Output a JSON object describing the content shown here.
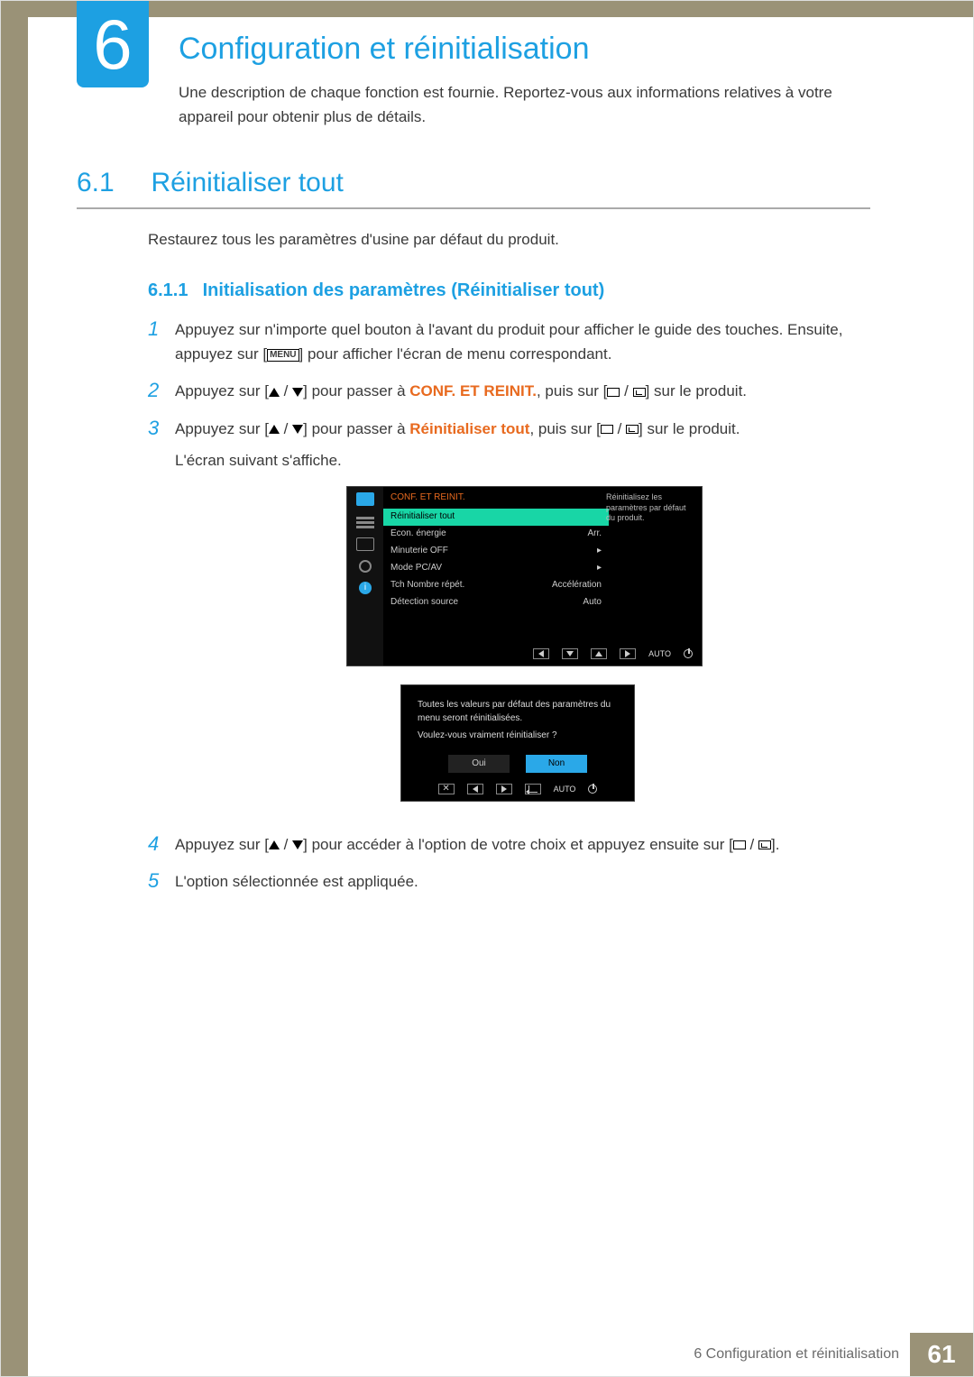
{
  "chapter": {
    "number": "6",
    "title": "Configuration et réinitialisation",
    "description": "Une description de chaque fonction est fournie. Reportez-vous aux informations relatives à votre appareil pour obtenir plus de détails."
  },
  "section": {
    "number": "6.1",
    "title": "Réinitialiser tout",
    "intro": "Restaurez tous les paramètres d'usine par défaut du produit."
  },
  "subsection": {
    "number": "6.1.1",
    "title": "Initialisation des paramètres (Réinitialiser tout)"
  },
  "steps": {
    "s1": {
      "num": "1",
      "text_a": "Appuyez sur n'importe quel bouton à l'avant du produit pour afficher le guide des touches. Ensuite, appuyez sur [",
      "menu": "MENU",
      "text_b": "] pour afficher l'écran de menu correspondant."
    },
    "s2": {
      "num": "2",
      "text_a": "Appuyez sur [",
      "text_b": "] pour passer à ",
      "target": "CONF. ET REINIT.",
      "text_c": ", puis sur [",
      "text_d": "] sur le produit."
    },
    "s3": {
      "num": "3",
      "text_a": "Appuyez sur [",
      "text_b": "] pour passer à ",
      "target": "Réinitialiser tout",
      "text_c": ", puis sur [",
      "text_d": "] sur le produit.",
      "text_e": "L'écran suivant s'affiche."
    },
    "s4": {
      "num": "4",
      "text_a": "Appuyez sur [",
      "text_b": "] pour accéder à l'option de votre choix et appuyez ensuite sur [",
      "text_c": "]."
    },
    "s5": {
      "num": "5",
      "text": "L'option sélectionnée est appliquée."
    }
  },
  "osd": {
    "header": "CONF. ET REINIT.",
    "items": [
      {
        "label": "Réinitialiser tout",
        "value": "",
        "selected": true
      },
      {
        "label": "Econ. énergie",
        "value": "Arr."
      },
      {
        "label": "Minuterie OFF",
        "value": "▸"
      },
      {
        "label": "Mode PC/AV",
        "value": "▸"
      },
      {
        "label": "Tch Nombre répét.",
        "value": "Accélération"
      },
      {
        "label": "Détection source",
        "value": "Auto"
      }
    ],
    "help": "Réinitialisez les paramètres par défaut du produit.",
    "auto": "AUTO"
  },
  "dialog": {
    "line1": "Toutes les valeurs par défaut des paramètres du menu seront réinitialisées.",
    "line2": "Voulez-vous vraiment réinitialiser ?",
    "yes": "Oui",
    "no": "Non",
    "auto": "AUTO"
  },
  "footer": {
    "chapter_ref": "6 Configuration et réinitialisation",
    "page": "61"
  }
}
